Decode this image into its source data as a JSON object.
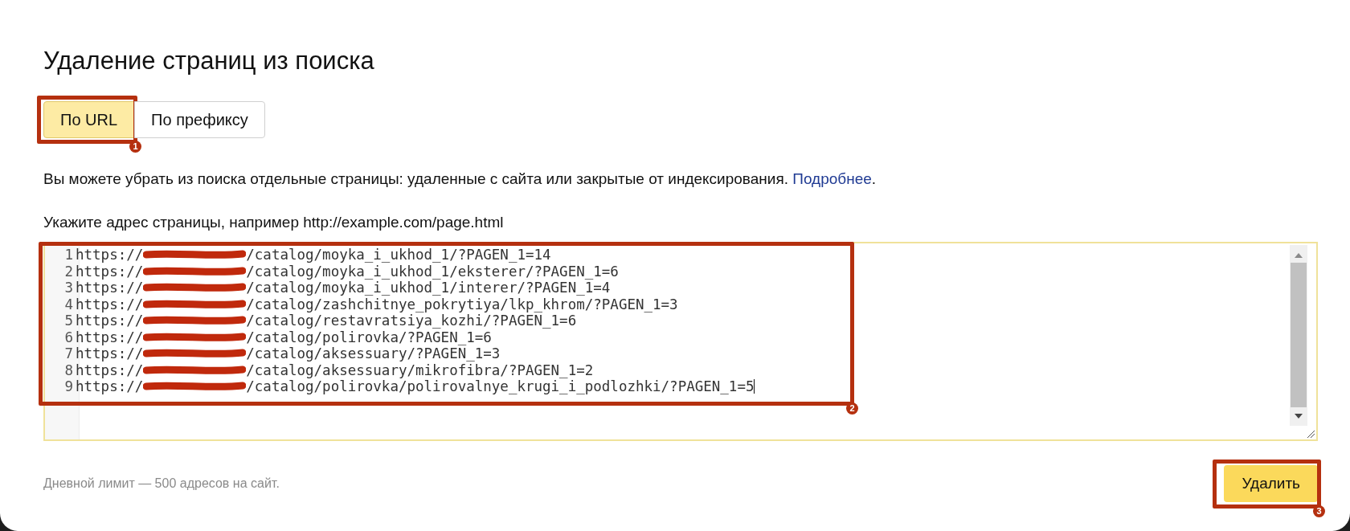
{
  "title": "Удаление страниц из поиска",
  "tabs": [
    {
      "label": "По URL",
      "selected": true,
      "annotation": "1"
    },
    {
      "label": "По префиксу",
      "selected": false
    }
  ],
  "description": {
    "text": "Вы можете убрать из поиска отдельные страницы: удаленные с сайта или закрытые от индексирования.",
    "link": "Подробнее",
    "after": "."
  },
  "field_label": "Укажите адрес страницы, например http://example.com/page.html",
  "editor": {
    "annotation": "2",
    "lines": [
      {
        "number": "1",
        "prefix": "https://",
        "path": "/catalog/moyka_i_ukhod_1/?PAGEN_1=14",
        "cursor": false
      },
      {
        "number": "2",
        "prefix": "https://",
        "path": "/catalog/moyka_i_ukhod_1/eksterer/?PAGEN_1=6",
        "cursor": false
      },
      {
        "number": "3",
        "prefix": "https://",
        "path": "/catalog/moyka_i_ukhod_1/interer/?PAGEN_1=4",
        "cursor": false
      },
      {
        "number": "4",
        "prefix": "https://",
        "path": "/catalog/zashchitnye_pokrytiya/lkp_khrom/?PAGEN_1=3",
        "cursor": false
      },
      {
        "number": "5",
        "prefix": "https://",
        "path": "/catalog/restavratsiya_kozhi/?PAGEN_1=6",
        "cursor": false
      },
      {
        "number": "6",
        "prefix": "https://",
        "path": "/catalog/polirovka/?PAGEN_1=6",
        "cursor": false
      },
      {
        "number": "7",
        "prefix": "https://",
        "path": "/catalog/aksessuary/?PAGEN_1=3",
        "cursor": false
      },
      {
        "number": "8",
        "prefix": "https://",
        "path": "/catalog/aksessuary/mikrofibra/?PAGEN_1=2",
        "cursor": false
      },
      {
        "number": "9",
        "prefix": "https://",
        "path": "/catalog/polirovka/polirovalnye_krugi_i_podlozhki/?PAGEN_1=5",
        "cursor": true
      }
    ]
  },
  "limit_note": "Дневной лимит — 500 адресов на сайт.",
  "delete_button": {
    "label": "Удалить",
    "annotation": "3"
  }
}
